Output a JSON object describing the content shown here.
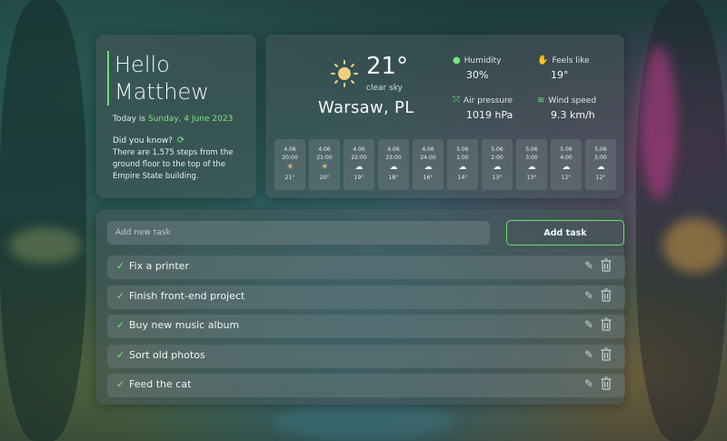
{
  "greeting": {
    "line1": "Hello",
    "line2": "Matthew",
    "today_prefix": "Today is",
    "today_date": "Sunday, 4 June 2023",
    "did_you_know": "Did you know?",
    "refresh_icon": "refresh-icon",
    "fact": "There are 1,575 steps from the ground floor to the top of the Empire State building."
  },
  "weather": {
    "temperature": "21°",
    "condition": "clear sky",
    "city": "Warsaw, PL",
    "humidity_label": "Humidity",
    "humidity_value": "30%",
    "feels_like_label": "Feels like",
    "feels_like_value": "19°",
    "pressure_label": "Air pressure",
    "pressure_value": "1019 hPa",
    "wind_label": "Wind speed",
    "wind_value": "9.3 km/h",
    "forecast": [
      {
        "date": "4.06",
        "time": "20:00",
        "icon": "sun",
        "temp": "21°"
      },
      {
        "date": "4.06",
        "time": "21:00",
        "icon": "sun",
        "temp": "20°"
      },
      {
        "date": "4.06",
        "time": "22:00",
        "icon": "cloud",
        "temp": "19°"
      },
      {
        "date": "4.06",
        "time": "23:00",
        "icon": "cloud",
        "temp": "18°"
      },
      {
        "date": "4.06",
        "time": "24:00",
        "icon": "cloud",
        "temp": "16°"
      },
      {
        "date": "5.06",
        "time": "1:00",
        "icon": "cloud",
        "temp": "14°"
      },
      {
        "date": "5.06",
        "time": "2:00",
        "icon": "cloud",
        "temp": "13°"
      },
      {
        "date": "5.06",
        "time": "3:00",
        "icon": "cloud",
        "temp": "13°"
      },
      {
        "date": "5.06",
        "time": "4:00",
        "icon": "cloud",
        "temp": "12°"
      },
      {
        "date": "5.06",
        "time": "5:00",
        "icon": "cloud",
        "temp": "12°"
      }
    ]
  },
  "tasks": {
    "input_placeholder": "Add new task",
    "add_button": "Add task",
    "items": [
      {
        "label": "Fix a printer"
      },
      {
        "label": "Finish front-end project"
      },
      {
        "label": "Buy new music album"
      },
      {
        "label": "Sort old photos"
      },
      {
        "label": "Feed the cat"
      }
    ]
  },
  "colors": {
    "accent": "#6fdc6f",
    "panel": "rgba(70,85,90,0.55)"
  }
}
